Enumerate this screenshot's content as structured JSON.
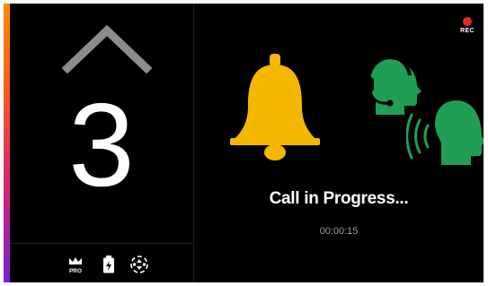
{
  "colors": {
    "accent_gradient": [
      "#ff8a00",
      "#e0246a",
      "#7a1fd6"
    ],
    "bell": "#f5b800",
    "agent_green": "#1f9e54",
    "rec_red": "#e8291c",
    "background": "#000000"
  },
  "floor_indicator": {
    "direction_icon": "chevron-up-icon",
    "floor": "3"
  },
  "status_bar": {
    "icons": [
      "pro-crown-icon",
      "battery-icon",
      "elevator-icon"
    ],
    "pro_label": "PRO"
  },
  "recording": {
    "label": "REC"
  },
  "call": {
    "alarm_icon": "alarm-bell-icon",
    "agent_icon": "headset-agent-icon",
    "speaker_icon": "speaking-person-icon",
    "status": "Call in Progress...",
    "elapsed": "00:00:15"
  }
}
